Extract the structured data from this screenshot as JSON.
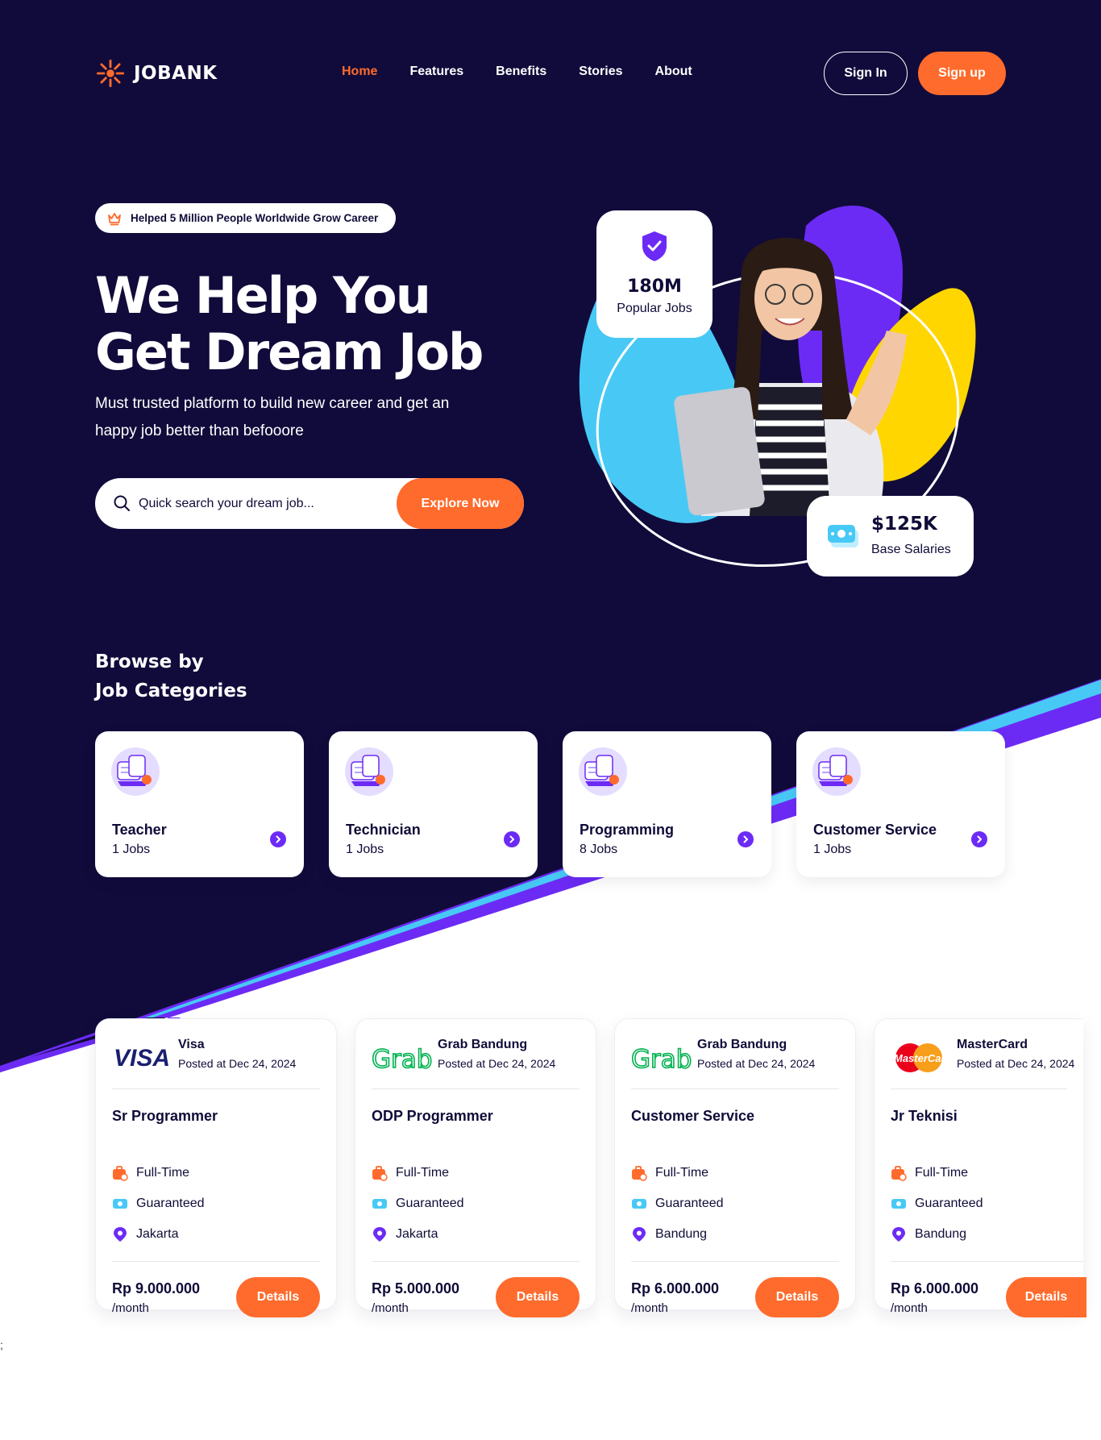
{
  "colors": {
    "navy": "#110b3b",
    "accent": "#ff6b2c",
    "purple": "#6c2bf5",
    "cyan": "#48c9f5",
    "yellow": "#ffd600",
    "white": "#ffffff"
  },
  "nav": {
    "brand": "JOBANK",
    "links": [
      "Home",
      "Features",
      "Benefits",
      "Stories",
      "About"
    ],
    "active": "Home",
    "signin": "Sign In",
    "signup": "Sign up"
  },
  "hero": {
    "badge": "Helped 5 Million People Worldwide Grow Career",
    "title_line1": "We Help You",
    "title_line2": "Get Dream Job",
    "subtitle": "Must trusted platform to build new career and get an happy job better than befooore",
    "search_placeholder": "Quick search your dream job...",
    "search_button": "Explore Now",
    "stat_jobs_value": "180M",
    "stat_jobs_label": "Popular Jobs",
    "stat_salary_value": "$125K",
    "stat_salary_label": "Base Salaries"
  },
  "categories": {
    "heading_line1": "Browse by",
    "heading_line2": "Job Categories",
    "items": [
      {
        "name": "Teacher",
        "count": "1 Jobs"
      },
      {
        "name": "Technician",
        "count": "1 Jobs"
      },
      {
        "name": "Programming",
        "count": "8 Jobs"
      },
      {
        "name": "Customer Service",
        "count": "1 Jobs"
      }
    ]
  },
  "jobs": [
    {
      "company": "Visa",
      "logo": "visa-logo",
      "posted": "Posted at Dec 24, 2024",
      "title": "Sr Programmer",
      "type": "Full-Time",
      "guarantee": "Guaranteed",
      "location": "Jakarta",
      "price": "Rp 9.000.000",
      "period": "/month",
      "button": "Details"
    },
    {
      "company": "Grab Bandung",
      "logo": "grab-logo",
      "posted": "Posted at Dec 24, 2024",
      "title": "ODP Programmer",
      "type": "Full-Time",
      "guarantee": "Guaranteed",
      "location": "Jakarta",
      "price": "Rp 5.000.000",
      "period": "/month",
      "button": "Details"
    },
    {
      "company": "Grab Bandung",
      "logo": "grab-logo",
      "posted": "Posted at Dec 24, 2024",
      "title": "Customer Service",
      "type": "Full-Time",
      "guarantee": "Guaranteed",
      "location": "Bandung",
      "price": "Rp 6.000.000",
      "period": "/month",
      "button": "Details"
    },
    {
      "company": "MasterCard",
      "logo": "mastercard-logo",
      "posted": "Posted at Dec 24, 2024",
      "title": "Jr Teknisi",
      "type": "Full-Time",
      "guarantee": "Guaranteed",
      "location": "Bandung",
      "price": "Rp 6.000.000",
      "period": "/month",
      "button": "Details"
    }
  ],
  "stray_text": ";"
}
